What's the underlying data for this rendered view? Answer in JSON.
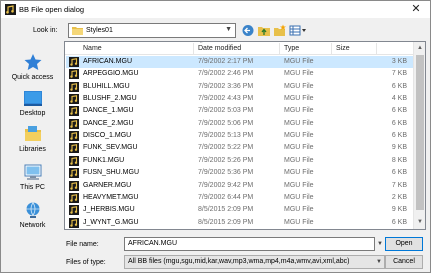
{
  "window": {
    "title": "BB File open dialog",
    "close_glyph": "✕"
  },
  "lookin": {
    "label": "Look in:",
    "value": "Styles01"
  },
  "places": [
    {
      "label": "Quick access",
      "icon": "star-icon"
    },
    {
      "label": "Desktop",
      "icon": "desktop-icon"
    },
    {
      "label": "Libraries",
      "icon": "libraries-icon"
    },
    {
      "label": "This PC",
      "icon": "computer-icon"
    },
    {
      "label": "Network",
      "icon": "network-icon"
    }
  ],
  "columns": {
    "name": "Name",
    "date": "Date modified",
    "type": "Type",
    "size": "Size"
  },
  "files": [
    {
      "name": "AFRICAN.MGU",
      "date": "7/9/2002 2:17 PM",
      "type": "MGU File",
      "size": "3 KB"
    },
    {
      "name": "ARPEGGIO.MGU",
      "date": "7/9/2002 2:46 PM",
      "type": "MGU File",
      "size": "7 KB"
    },
    {
      "name": "BLUHILL.MGU",
      "date": "7/9/2002 3:36 PM",
      "type": "MGU File",
      "size": "6 KB"
    },
    {
      "name": "BLUSHF_2.MGU",
      "date": "7/9/2002 4:43 PM",
      "type": "MGU File",
      "size": "4 KB"
    },
    {
      "name": "DANCE_1.MGU",
      "date": "7/9/2002 5:03 PM",
      "type": "MGU File",
      "size": "6 KB"
    },
    {
      "name": "DANCE_2.MGU",
      "date": "7/9/2002 5:06 PM",
      "type": "MGU File",
      "size": "6 KB"
    },
    {
      "name": "DISCO_1.MGU",
      "date": "7/9/2002 5:13 PM",
      "type": "MGU File",
      "size": "6 KB"
    },
    {
      "name": "FUNK_SEV.MGU",
      "date": "7/9/2002 5:22 PM",
      "type": "MGU File",
      "size": "9 KB"
    },
    {
      "name": "FUNK1.MGU",
      "date": "7/9/2002 5:26 PM",
      "type": "MGU File",
      "size": "8 KB"
    },
    {
      "name": "FUSN_SHU.MGU",
      "date": "7/9/2002 5:36 PM",
      "type": "MGU File",
      "size": "6 KB"
    },
    {
      "name": "GARNER.MGU",
      "date": "7/9/2002 9:42 PM",
      "type": "MGU File",
      "size": "7 KB"
    },
    {
      "name": "HEAVYMET.MGU",
      "date": "7/9/2002 6:44 PM",
      "type": "MGU File",
      "size": "2 KB"
    },
    {
      "name": "J_HERBIS.MGU",
      "date": "8/5/2015 2:09 PM",
      "type": "MGU File",
      "size": "9 KB"
    },
    {
      "name": "J_WYNT_G.MGU",
      "date": "8/5/2015 2:09 PM",
      "type": "MGU File",
      "size": "6 KB"
    }
  ],
  "selected_index": 0,
  "filename": {
    "label": "File name:",
    "value": "AFRICAN.MGU"
  },
  "filetype": {
    "label": "Files of type:",
    "value": "All BB files (mgu,sgu,mid,kar,wav,mp3,wma,mp4,m4a,wmv,avi,xml,abc)"
  },
  "buttons": {
    "open": "Open",
    "cancel": "Cancel"
  },
  "colors": {
    "selection": "#cce8ff",
    "folder": "#e8c04a",
    "accent": "#0078d7"
  }
}
